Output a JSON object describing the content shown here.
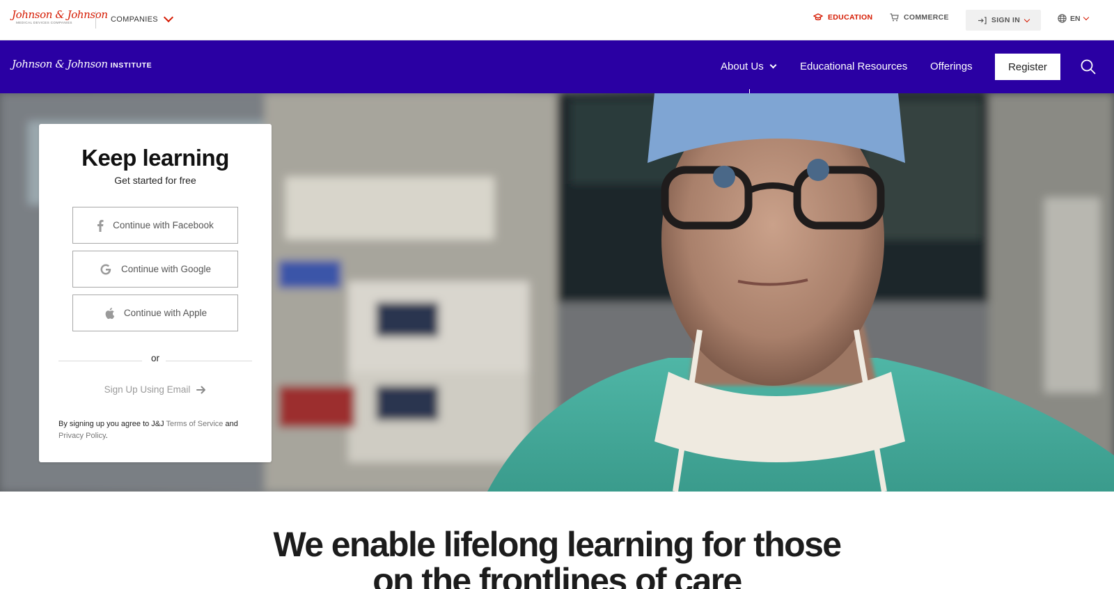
{
  "brand": {
    "logo_script": "Johnson & Johnson",
    "logo_sub": "MEDICAL DEVICES COMPANIES",
    "institute_script": "Johnson & Johnson",
    "institute_label": "INSTITUTE",
    "accent_red": "#d51900",
    "nav_blue": "#2a00a3"
  },
  "topbar": {
    "companies_label": "COMPANIES",
    "education_label": "EDUCATION",
    "commerce_label": "COMMERCE",
    "signin_label": "SIGN IN",
    "language_label": "EN"
  },
  "nav": {
    "about_label": "About Us",
    "resources_label": "Educational Resources",
    "offerings_label": "Offerings",
    "register_label": "Register"
  },
  "signup": {
    "title": "Keep learning",
    "subtitle": "Get started for free",
    "facebook_label": "Continue with Facebook",
    "google_label": "Continue with Google",
    "apple_label": "Continue with Apple",
    "or_label": "or",
    "email_label": "Sign Up Using Email",
    "terms_prefix": "By signing up you agree to J&J",
    "terms_link": "Terms of Service",
    "terms_and": "and",
    "privacy_link": "Privacy Policy",
    "terms_suffix": "."
  },
  "hero": {
    "image_subject": "surgeon-portrait"
  },
  "main": {
    "headline_line1": "We enable lifelong learning for those",
    "headline_line2": "on the frontlines of care"
  }
}
